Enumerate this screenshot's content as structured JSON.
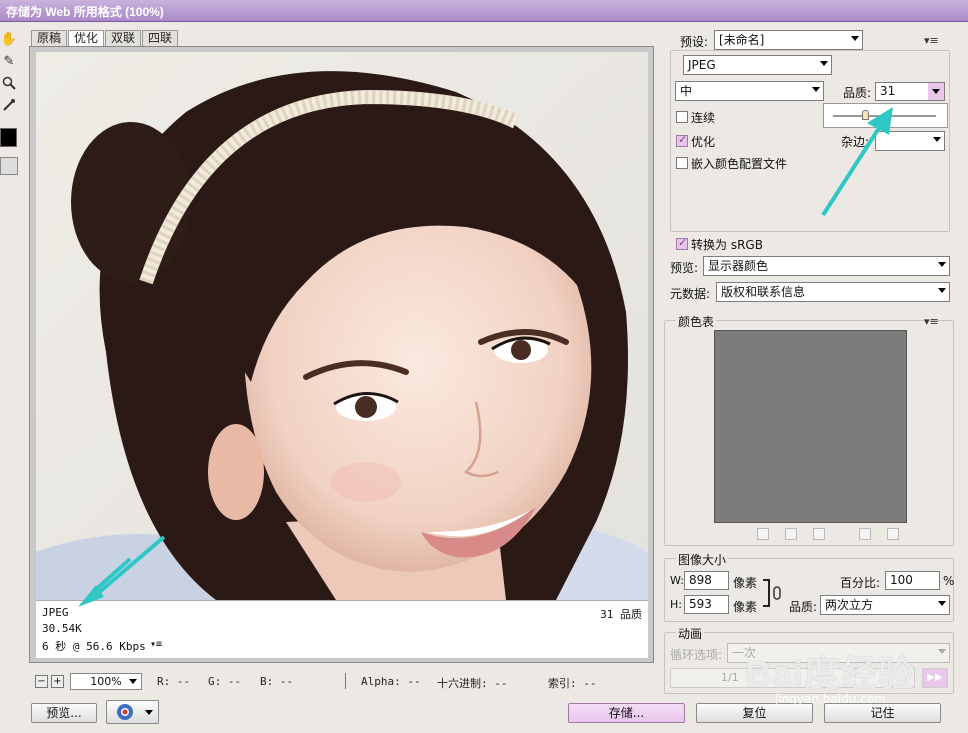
{
  "window": {
    "title": "存储为 Web 所用格式 (100%)"
  },
  "view_tabs": [
    "原稿",
    "优化",
    "双联",
    "四联"
  ],
  "image_info": {
    "format": "JPEG",
    "size": "30.54K",
    "speed": "6 秒 @ 56.6 Kbps",
    "quality": "31 品质"
  },
  "status_bar": {
    "zoom": "100%",
    "r": "R: --",
    "g": "G: --",
    "b": "B: --",
    "alpha": "Alpha: --",
    "hex": "十六进制: --",
    "index": "索引: --"
  },
  "buttons": {
    "preview": "预览...",
    "save": "存储...",
    "reset": "复位",
    "remember": "记住"
  },
  "settings": {
    "preset_label": "预设:",
    "preset_value": "[未命名]",
    "format": "JPEG",
    "compression": "中",
    "quality_label": "品质:",
    "quality_value": "31",
    "progressive_label": "连续",
    "optimized_label": "优化",
    "matte_label": "杂边:",
    "embed_profile_label": "嵌入颜色配置文件",
    "convert_srgb_label": "转换为 sRGB",
    "preview_label": "预览:",
    "preview_value": "显示器颜色",
    "metadata_label": "元数据:",
    "metadata_value": "版权和联系信息"
  },
  "color_table": {
    "title": "颜色表"
  },
  "image_size": {
    "title": "图像大小",
    "w_label": "W:",
    "w_value": "898",
    "h_label": "H:",
    "h_value": "593",
    "unit": "像素",
    "percent_label": "百分比:",
    "percent_value": "100",
    "percent_unit": "%",
    "quality_label": "品质:",
    "quality_value": "两次立方"
  },
  "animation": {
    "title": "动画",
    "loop_label": "循环选项:",
    "loop_value": "一次",
    "frame_counter": "1/1"
  },
  "watermark": {
    "text": "Bai度经验",
    "sub": "jingyan.baidu.com"
  },
  "colors": {
    "accent": "#e9c7eb",
    "titlebar": "#a98ac8",
    "annotation_arrow": "#2fc7c6"
  }
}
